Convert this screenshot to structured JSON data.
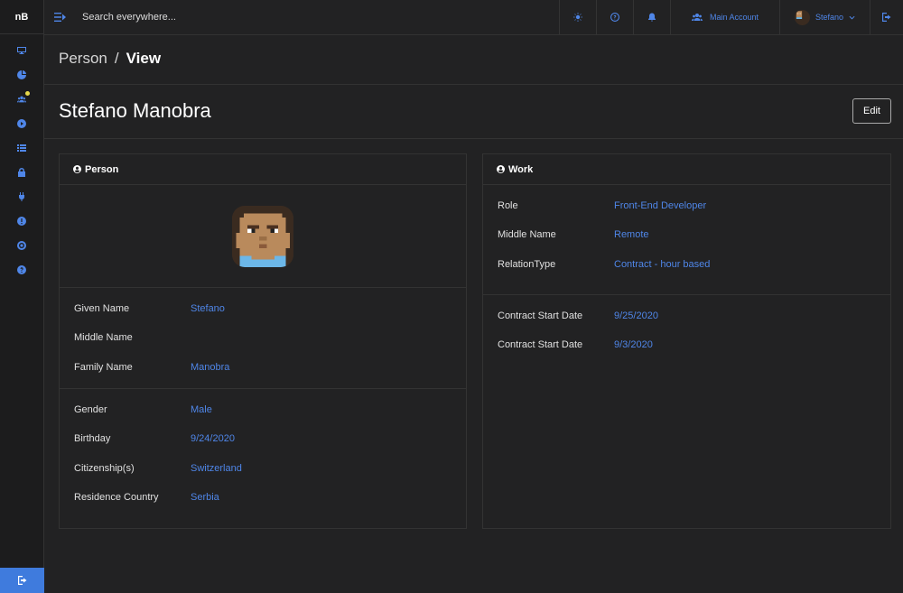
{
  "app": {
    "logo": "nB"
  },
  "sidebar": {
    "items": [
      {
        "icon": "monitor-icon"
      },
      {
        "icon": "dashboard-icon"
      },
      {
        "icon": "users-icon",
        "badge": true
      },
      {
        "icon": "play-circle-icon"
      },
      {
        "icon": "list-icon"
      },
      {
        "icon": "lock-icon"
      },
      {
        "icon": "plug-icon"
      },
      {
        "icon": "alert-icon"
      },
      {
        "icon": "settings-circle-icon"
      },
      {
        "icon": "help-icon"
      }
    ],
    "bottom_icon": "sign-out-icon"
  },
  "topbar": {
    "search_placeholder": "Search everywhere...",
    "account_label": "Main Account",
    "user_label": "Stefano"
  },
  "breadcrumb": {
    "parent": "Person",
    "separator": "/",
    "current": "View"
  },
  "page": {
    "title": "Stefano Manobra",
    "edit_label": "Edit"
  },
  "person_card": {
    "title": "Person",
    "section1": [
      {
        "label": "Given Name",
        "value": "Stefano"
      },
      {
        "label": "Middle Name",
        "value": ""
      },
      {
        "label": "Family Name",
        "value": "Manobra"
      }
    ],
    "section2": [
      {
        "label": "Gender",
        "value": "Male"
      },
      {
        "label": "Birthday",
        "value": "9/24/2020"
      },
      {
        "label": "Citizenship(s)",
        "value": "Switzerland"
      },
      {
        "label": "Residence Country",
        "value": "Serbia"
      }
    ]
  },
  "work_card": {
    "title": "Work",
    "section1": [
      {
        "label": "Role",
        "value": "Front-End Developer"
      },
      {
        "label": "Middle Name",
        "value": "Remote"
      },
      {
        "label": "RelationType",
        "value": "Contract - hour based"
      }
    ],
    "section2": [
      {
        "label": "Contract Start Date",
        "value": "9/25/2020"
      },
      {
        "label": "Contract Start Date",
        "value": "9/3/2020"
      }
    ]
  },
  "colors": {
    "accent": "#4f86e8",
    "background": "#222223",
    "sidebar": "#1c1c1d",
    "badge": "#e6d84a"
  }
}
